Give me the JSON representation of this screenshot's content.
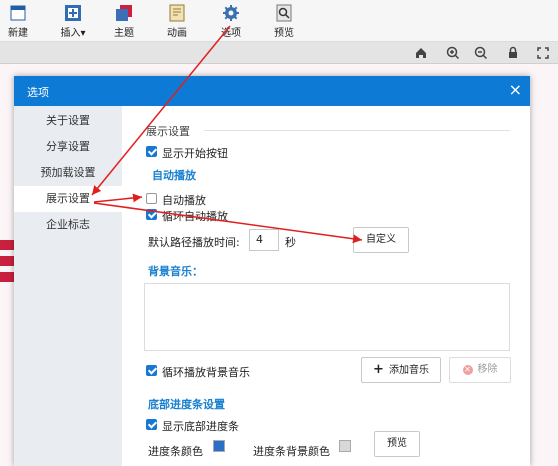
{
  "toolbar": {
    "items": [
      {
        "label": "新建",
        "icon": "new-icon"
      },
      {
        "label": "插入",
        "icon": "insert-icon",
        "dropdown": "▾"
      },
      {
        "label": "主题",
        "icon": "theme-icon"
      },
      {
        "label": "动画",
        "icon": "animation-icon"
      },
      {
        "label": "选项",
        "icon": "options-gear-icon"
      },
      {
        "label": "预览",
        "icon": "preview-icon"
      }
    ]
  },
  "subbar": {
    "icons": [
      "home-icon",
      "zoom-in-icon",
      "zoom-out-icon",
      "lock-icon",
      "expand-icon"
    ]
  },
  "dialog": {
    "title": "选项",
    "close": "×",
    "sidebar": [
      {
        "label": "关于设置",
        "active": false
      },
      {
        "label": "分享设置",
        "active": false
      },
      {
        "label": "预加载设置",
        "active": false
      },
      {
        "label": "展示设置",
        "active": true
      },
      {
        "label": "企业标志",
        "active": false
      }
    ],
    "content": {
      "section_title": "展示设置",
      "show_start_button": {
        "label": "显示开始按钮",
        "checked": true
      },
      "autoplay_title": "自动播放",
      "autoplay": {
        "label": "自动播放",
        "checked": false
      },
      "loop_autoplay": {
        "label": "循环自动播放",
        "checked": true
      },
      "default_interval_label": "默认路径播放时间:",
      "default_interval_value": "4",
      "seconds_unit": "秒",
      "custom_button": "自定义",
      "bgm_title": "背景音乐：",
      "loop_bgm": {
        "label": "循环播放背景音乐",
        "checked": true
      },
      "add_music_button": "添加音乐",
      "add_music_icon": "+",
      "remove_button": "移除",
      "progress_title": "底部进度条设置",
      "show_progress": {
        "label": "显示底部进度条",
        "checked": true
      },
      "progress_color_label": "进度条颜色",
      "progress_bg_color_label": "进度条背景颜色",
      "preview_button": "预览"
    }
  },
  "colors": {
    "accent": "#0d7ad6",
    "arrow": "#e02020",
    "sidebar_bg": "#e9ecf1"
  }
}
